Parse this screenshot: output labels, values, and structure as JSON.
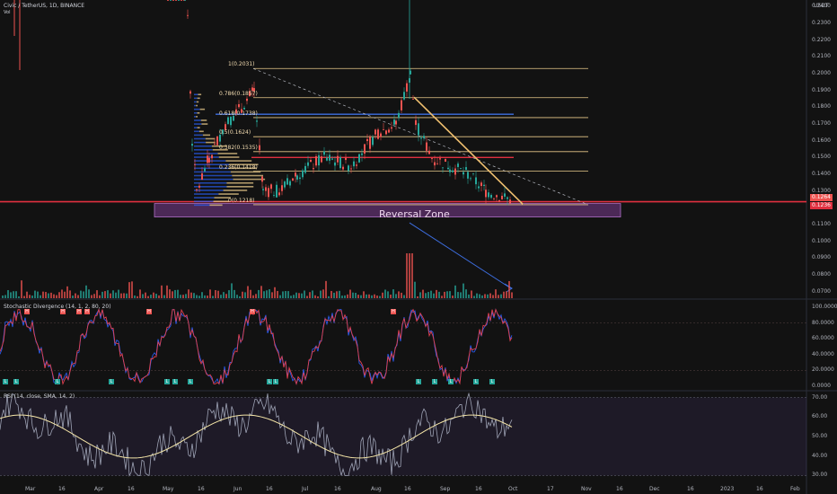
{
  "header": {
    "symbol_line": "Civic / TetherUS, 1D, BINANCE",
    "vol_label": "Vol",
    "currency": "USDT"
  },
  "chart_data": {
    "type": "candlestick",
    "panes": [
      {
        "name": "price",
        "y_ticks": [
          "0.2400",
          "0.2300",
          "0.2200",
          "0.2100",
          "0.2000",
          "0.1900",
          "0.1800",
          "0.1700",
          "0.1600",
          "0.1500",
          "0.1400",
          "0.1300",
          "0.1100",
          "0.1000",
          "0.0900",
          "0.0800",
          "0.0700"
        ],
        "ylim": [
          0.066,
          0.244
        ],
        "last_price": "0.1236",
        "current_tag": "0.1264",
        "fib_levels": [
          {
            "label": "1(0.2031)",
            "value": 0.2031
          },
          {
            "label": "0.786(0.1857)",
            "value": 0.1857
          },
          {
            "label": "0.618(0.1738)",
            "value": 0.1738
          },
          {
            "label": "0.5(0.1624)",
            "value": 0.1624
          },
          {
            "label": "0.382(0.1535)",
            "value": 0.1535
          },
          {
            "label": "0.236(0.1418)",
            "value": 0.1418
          },
          {
            "label": "0(0.1218)",
            "value": 0.1218
          }
        ],
        "annotations": [
          "Reversal Zone"
        ]
      },
      {
        "name": "Stochastic Divergence (14, 1, 2, 80, 20)",
        "y_ticks": [
          "100.0000",
          "80.0000",
          "60.0000",
          "40.0000",
          "20.0000",
          "0.0000"
        ],
        "ylim": [
          0,
          100
        ],
        "high_marks": 9,
        "low_marks": 14
      },
      {
        "name": "RSI (14, close, SMA, 14, 2)",
        "y_ticks": [
          "70.00",
          "60.00",
          "50.00",
          "40.00",
          "30.00"
        ],
        "ylim": [
          27,
          73
        ]
      }
    ],
    "x_ticks": [
      "Mar",
      "16",
      "Apr",
      "16",
      "May",
      "16",
      "Jun",
      "16",
      "Jul",
      "16",
      "Aug",
      "16",
      "Sep",
      "16",
      "Oct",
      "17",
      "Nov",
      "16",
      "Dec",
      "16",
      "2023",
      "16",
      "Feb"
    ]
  },
  "labels": {
    "stoch_title": "Stochastic Divergence (14, 1, 2, 80, 20)",
    "rsi_title": "RSI (14, close, SMA, 14, 2)",
    "zone_text": "Reversal Zone",
    "high_mark": "H",
    "low_mark": "L"
  },
  "colors": {
    "background": "#121212",
    "up": "#26a69a",
    "down": "#ef5350",
    "fib_line": "#e8c98a",
    "blue_line": "#3d6ee0",
    "red_line": "#e03040",
    "zone_fill": "#7b3d8f",
    "trend_line": "#f0c070",
    "rsi_line": "#9ea3b5",
    "rsi_ma": "#f5e6a8"
  }
}
